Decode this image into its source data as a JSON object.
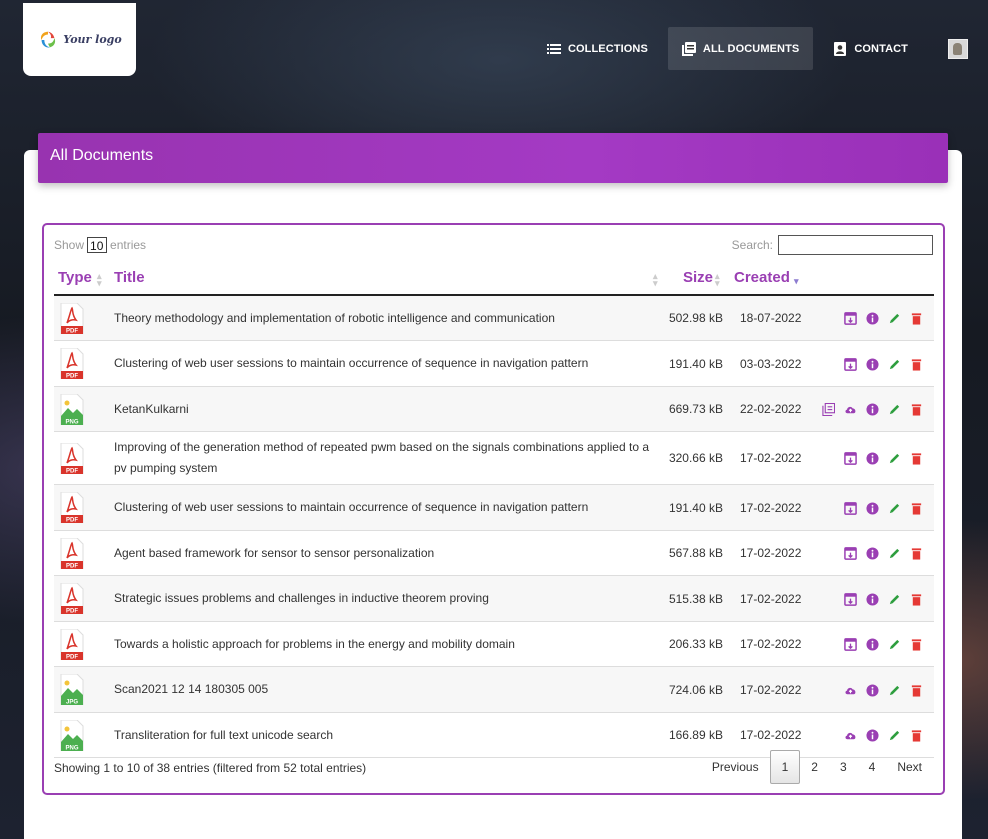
{
  "logo": {
    "text": "Your logo"
  },
  "nav": {
    "items": [
      {
        "label": "COLLECTIONS",
        "icon": "list-icon",
        "active": false
      },
      {
        "label": "ALL DOCUMENTS",
        "icon": "documents-icon",
        "active": true
      },
      {
        "label": "CONTACT",
        "icon": "contact-card-icon",
        "active": false
      }
    ]
  },
  "page": {
    "title": "All Documents"
  },
  "controls": {
    "show_label": "Show",
    "entries_label": "entries",
    "page_length": "10",
    "search_label": "Search:",
    "search_value": ""
  },
  "table": {
    "headers": {
      "type": "Type",
      "title": "Title",
      "size": "Size",
      "created": "Created"
    },
    "rows": [
      {
        "type": "PDF",
        "title": "Theory methodology and implementation of robotic intelligence and communication",
        "size": "502.98 kB",
        "created": "18-07-2022",
        "actions": [
          "archive",
          "info",
          "edit",
          "delete"
        ]
      },
      {
        "type": "PDF",
        "title": "Clustering of web user sessions to maintain occurrence of sequence in navigation pattern",
        "size": "191.40 kB",
        "created": "03-03-2022",
        "actions": [
          "archive",
          "info",
          "edit",
          "delete"
        ]
      },
      {
        "type": "PNG",
        "title": "KetanKulkarni",
        "size": "669.73 kB",
        "created": "22-02-2022",
        "actions": [
          "copy",
          "upload",
          "info",
          "edit",
          "delete"
        ]
      },
      {
        "type": "PDF",
        "title": "Improving of the generation method of repeated pwm based on the signals combinations applied to a pv pumping system",
        "size": "320.66 kB",
        "created": "17-02-2022",
        "actions": [
          "archive",
          "info",
          "edit",
          "delete"
        ]
      },
      {
        "type": "PDF",
        "title": "Clustering of web user sessions to maintain occurrence of sequence in navigation pattern",
        "size": "191.40 kB",
        "created": "17-02-2022",
        "actions": [
          "archive",
          "info",
          "edit",
          "delete"
        ]
      },
      {
        "type": "PDF",
        "title": "Agent based framework for sensor to sensor personalization",
        "size": "567.88 kB",
        "created": "17-02-2022",
        "actions": [
          "archive",
          "info",
          "edit",
          "delete"
        ]
      },
      {
        "type": "PDF",
        "title": "Strategic issues problems and challenges in inductive theorem proving",
        "size": "515.38 kB",
        "created": "17-02-2022",
        "actions": [
          "archive",
          "info",
          "edit",
          "delete"
        ]
      },
      {
        "type": "PDF",
        "title": "Towards a holistic approach for problems in the energy and mobility domain",
        "size": "206.33 kB",
        "created": "17-02-2022",
        "actions": [
          "archive",
          "info",
          "edit",
          "delete"
        ]
      },
      {
        "type": "JPG",
        "title": "Scan2021 12 14 180305 005",
        "size": "724.06 kB",
        "created": "17-02-2022",
        "actions": [
          "upload",
          "info",
          "edit",
          "delete"
        ]
      },
      {
        "type": "PNG",
        "title": "Transliteration for full text unicode search",
        "size": "166.89 kB",
        "created": "17-02-2022",
        "actions": [
          "upload",
          "info",
          "edit",
          "delete"
        ]
      }
    ]
  },
  "footer": {
    "info": "Showing 1 to 10 of 38 entries (filtered from 52 total entries)",
    "previous": "Previous",
    "next": "Next",
    "pages": [
      "1",
      "2",
      "3",
      "4"
    ],
    "current_page": "1"
  },
  "colors": {
    "accent": "#9a3fb3",
    "edit": "#2e9e3e",
    "delete": "#e53935",
    "pdf": "#d9342b",
    "image_file": "#4caf50"
  }
}
